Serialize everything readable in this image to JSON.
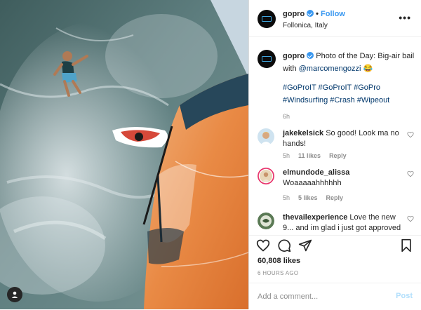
{
  "header": {
    "username": "gopro",
    "separator": "•",
    "follow_label": "Follow",
    "location": "Follonica, Italy",
    "more_label": "•••"
  },
  "caption": {
    "username": "gopro",
    "text": "Photo of the Day: Big-air bail with",
    "mention": "@marcomengozzi",
    "emoji": "😂",
    "hashtags": "#GoProIT #GoProIT #GoPro #Windsurfing #Crash #Wipeout",
    "time": "6h"
  },
  "comments": [
    {
      "username": "jakekelsick",
      "text": "So good! Look ma no hands!",
      "time": "5h",
      "likes": "11 likes",
      "reply": "Reply"
    },
    {
      "username": "elmundode_alissa",
      "text": "Woaaaaahhhhhh",
      "time": "5h",
      "likes": "5 likes",
      "reply": "Reply"
    },
    {
      "username": "thevailexperience",
      "text": "Love the new 9... and im glad i just got approved"
    }
  ],
  "actions": {
    "icons": [
      "heart-icon",
      "comment-icon",
      "share-icon",
      "bookmark-icon"
    ],
    "likes": "60,808 likes",
    "time_ago": "6 HOURS AGO"
  },
  "add_comment": {
    "placeholder": "Add a comment...",
    "post_label": "Post"
  },
  "colors": {
    "accent": "#3897f0",
    "link": "#00376b",
    "muted": "#8e8e8e",
    "post_disabled": "#b2dffc"
  }
}
